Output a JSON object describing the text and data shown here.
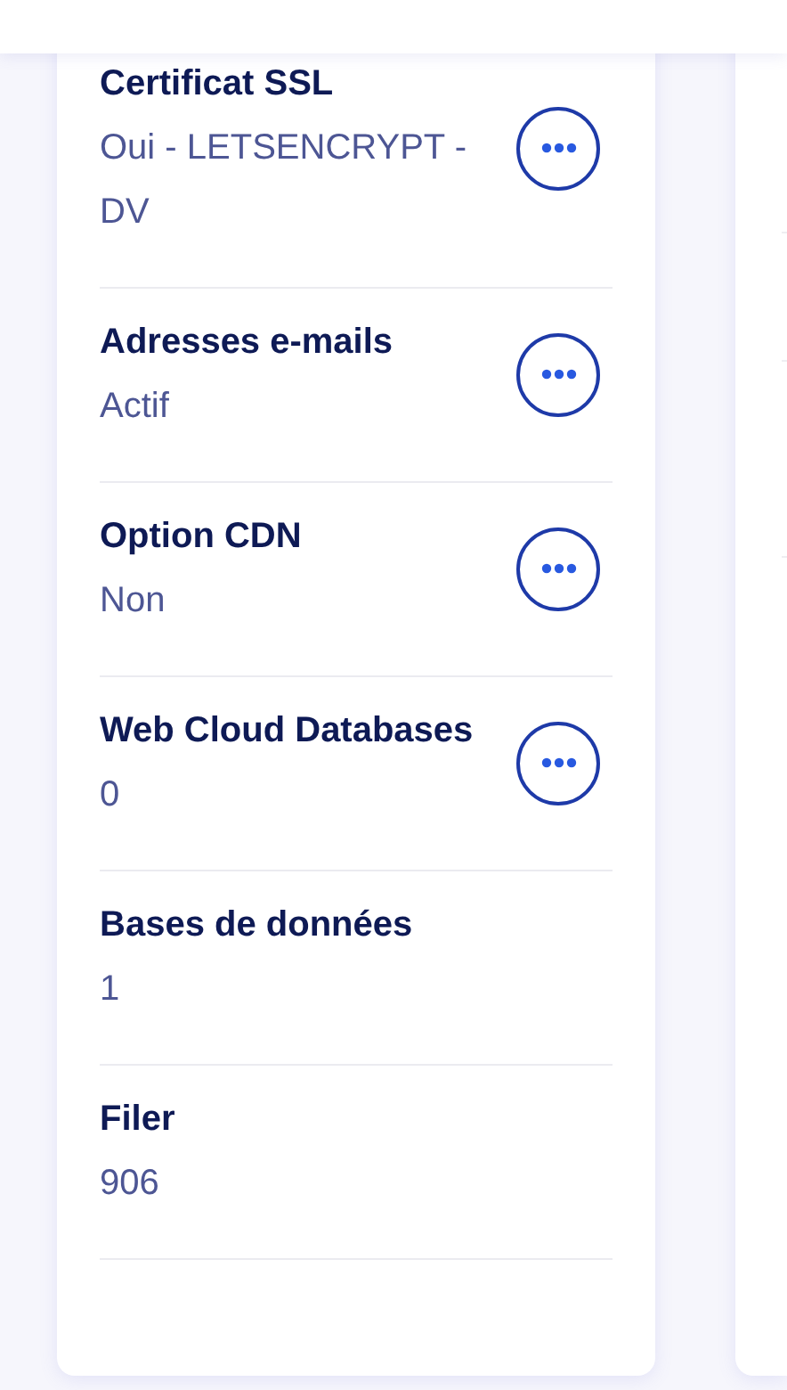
{
  "items": [
    {
      "title": "Certificat SSL",
      "value": "Oui - LETSENCRYPT - DV",
      "menu": true
    },
    {
      "title": "Adresses e-mails",
      "value": "Actif",
      "menu": true
    },
    {
      "title": "Option CDN",
      "value": "Non",
      "menu": true
    },
    {
      "title": "Web Cloud Databases",
      "value": "0",
      "menu": true
    },
    {
      "title": "Bases de données",
      "value": "1",
      "menu": false
    },
    {
      "title": "Filer",
      "value": "906",
      "menu": false
    }
  ]
}
